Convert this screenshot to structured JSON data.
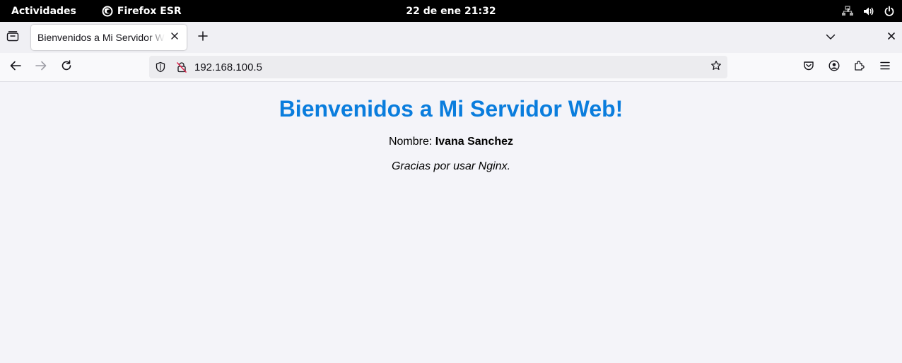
{
  "topbar": {
    "activities": "Actividades",
    "app_name": "Firefox ESR",
    "clock": "22 de ene  21:32"
  },
  "browser": {
    "tab": {
      "title": "Bienvenidos a Mi Servidor Web"
    },
    "url": "192.168.100.5"
  },
  "page": {
    "heading": "Bienvenidos a Mi Servidor Web!",
    "name_label": "Nombre:",
    "name_value": "Ivana Sanchez",
    "thanks": "Gracias por usar Nginx."
  },
  "colors": {
    "heading": "#0a7ddd",
    "topbar_bg": "#000000",
    "content_bg": "#f4f4f9"
  },
  "icons": [
    "firefox-icon",
    "network-icon",
    "volume-icon",
    "power-icon",
    "tab-overview-icon",
    "close-icon",
    "plus-icon",
    "chevron-down-icon",
    "back-icon",
    "forward-icon",
    "reload-icon",
    "shield-icon",
    "insecure-lock-icon",
    "star-icon",
    "pocket-icon",
    "account-icon",
    "extensions-icon",
    "menu-icon"
  ]
}
